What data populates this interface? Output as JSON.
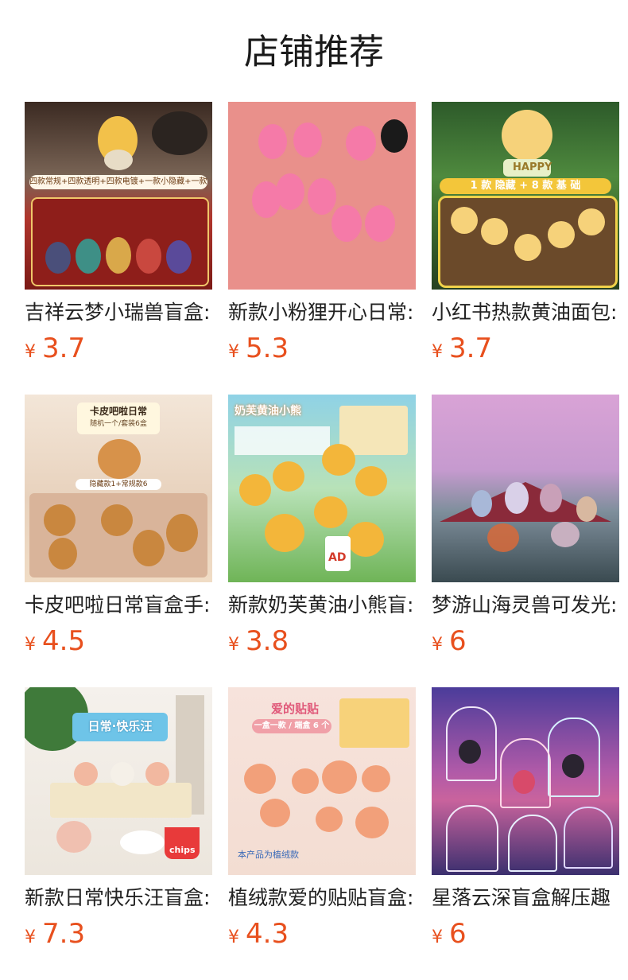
{
  "header": {
    "title": "店铺推荐"
  },
  "currency_symbol": "¥",
  "colors": {
    "price": "#e8501e",
    "title": "#1a1a1a",
    "name": "#222222"
  },
  "products": [
    {
      "name": "吉祥云梦小瑞兽盲盒:",
      "price": "3.7",
      "thumb_text": "四款常规+四款透明+四款电镀+一款小隐藏+一款大隐藏"
    },
    {
      "name": "新款小粉狸开心日常:",
      "price": "5.3"
    },
    {
      "name": "小红书热款黄油面包:",
      "price": "3.7",
      "thumb_text": "1 款 隐藏 + 8 款 基 础",
      "thumb_text2": "HAPPY"
    },
    {
      "name": "卡皮吧啦日常盲盒手:",
      "price": "4.5",
      "thumb_text": "卡皮吧啦日常",
      "thumb_text2": "随机一个/套装6盒",
      "thumb_text3": "隐藏款1+常规款6"
    },
    {
      "name": "新款奶芙黄油小熊盲:",
      "price": "3.8",
      "thumb_text": "奶芙黄油小熊",
      "thumb_text2": "AD"
    },
    {
      "name": "梦游山海灵兽可发光:",
      "price": "6"
    },
    {
      "name": "新款日常快乐汪盲盒:",
      "price": "7.3",
      "thumb_text": "日常·快乐汪",
      "thumb_text2": "chips"
    },
    {
      "name": "植绒款爱的贴贴盲盒:",
      "price": "4.3",
      "thumb_text": "爱的贴贴",
      "thumb_text2": "一盒一款 / 端盒 6 个",
      "thumb_text3": "本产品为植绒款"
    },
    {
      "name": "星落云深盲盒解压趣",
      "price": "6"
    }
  ]
}
